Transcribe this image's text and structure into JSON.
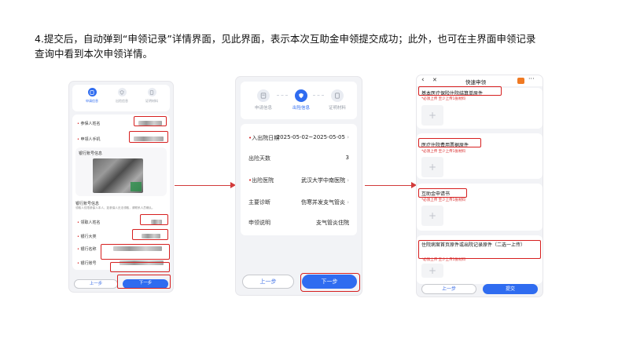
{
  "instruction": {
    "line1": "4.提交后，自动弹到“申领记录”详情界面，见此界面，表示本次互助金申领提交成功；此外，也可在主界面申领记录",
    "line2": "查询中看到本次申领详情。"
  },
  "steps": {
    "s1": "申请信息",
    "s2": "出险信息",
    "s3": "证明材料"
  },
  "phone1": {
    "insured_name_label": "参保人姓名",
    "applicant_phone_label": "申领人手机",
    "bank_info_title": "银行账号信息",
    "bank_info_section": "银行账号信息",
    "bank_note": "领取人仅限参保人本人，如参保人无法领取，请联系人员确认。",
    "payee_name_label": "领取人姓名",
    "bank_type_label": "银行大类",
    "bank_name_label": "银行名称",
    "bank_account_label": "银行账号",
    "prev_button": "上一步",
    "next_button": "下一步"
  },
  "phone2": {
    "rows": [
      {
        "key": "入出院日期",
        "value": "2025-05-02~2025-05-05",
        "chevron": true,
        "required": true
      },
      {
        "key": "出险天数",
        "value": "3",
        "chevron": false,
        "required": false
      },
      {
        "key": "出险医院",
        "value": "武汉大学中南医院",
        "chevron": true,
        "required": true
      },
      {
        "key": "主要诊断",
        "value": "伤寒并发支气管炎",
        "chevron": true,
        "required": false
      },
      {
        "key": "申领说明",
        "value": "支气管炎住院",
        "chevron": false,
        "required": false
      }
    ],
    "prev_button": "上一步",
    "next_button": "下一步"
  },
  "phone3": {
    "header_title": "快速申领",
    "sections": [
      {
        "title": "基本医疗保险住院结算单原件",
        "note": "*必须上传 至少上传1张材料"
      },
      {
        "title": "医疗住院费用票据原件",
        "note": "*必须上传 至少上传1张材料"
      },
      {
        "title": "互助金申请书",
        "note": "*必须上传 至少上传1张材料"
      },
      {
        "title": "住院病案首页原件或出院记录原件（二选一上传）",
        "note": "*必须上传 至少上传1张材料"
      }
    ],
    "prev_button": "上一步",
    "submit_button": "提交"
  },
  "colors": {
    "accent": "#2f6cf0",
    "annotation_red": "#d61f1f"
  }
}
